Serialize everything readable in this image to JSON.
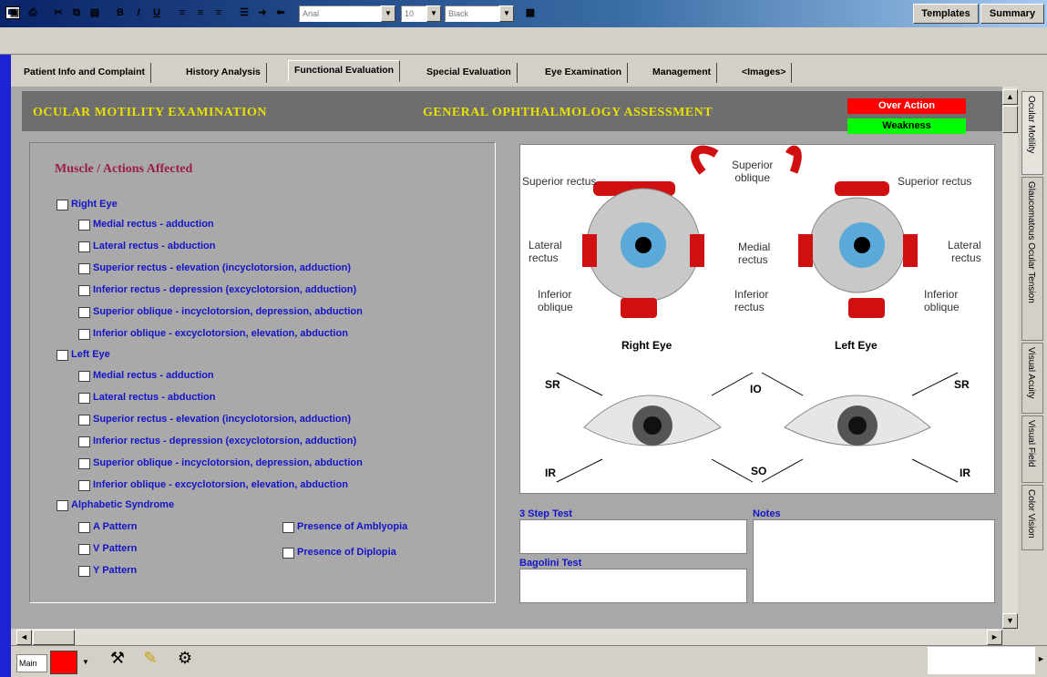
{
  "toolbar": {
    "bold": "B",
    "italic": "I",
    "underline": "U",
    "font_name": "Arial",
    "font_size": "10",
    "font_color": "Black",
    "templates_label": "Templates",
    "summary_label": "Summary"
  },
  "window": {
    "minimize": "_",
    "restore": "□",
    "close": "x"
  },
  "tabs": [
    "Patient Info and Complaint",
    "History Analysis",
    "Functional Evaluation",
    "Special Evaluation",
    "Eye Examination",
    "Management",
    "<Images>"
  ],
  "header": {
    "left_title": "OCULAR MOTILITY EXAMINATION",
    "right_title": "GENERAL OPHTHALMOLOGY ASSESSMENT"
  },
  "legend": {
    "over_action": "Over Action",
    "weakness": "Weakness",
    "over_color": "#ff0000",
    "weak_color": "#00ff00"
  },
  "panel": {
    "title": "Muscle / Actions Affected",
    "right_eye": "Right Eye",
    "right_items": [
      "Medial rectus - adduction",
      "Lateral rectus - abduction",
      "Superior rectus - elevation (incyclotorsion, adduction)",
      "Inferior rectus - depression (excyclotorsion, adduction)",
      "Superior oblique - incyclotorsion, depression, abduction",
      "Inferior oblique - excyclotorsion, elevation, abduction"
    ],
    "left_eye": "Left Eye",
    "left_items": [
      "Medial rectus - adduction",
      "Lateral rectus - abduction",
      "Superior rectus - elevation (incyclotorsion, adduction)",
      "Inferior rectus - depression (excyclotorsion, adduction)",
      "Superior oblique - incyclotorsion, depression, abduction",
      "Inferior oblique - excyclotorsion, elevation, abduction"
    ],
    "alphabetic": "Alphabetic Syndrome",
    "patterns": [
      "A Pattern",
      "V Pattern",
      "Y Pattern"
    ],
    "amblyopia": "Presence of Amblyopia",
    "diplopia": "Presence of Diplopia"
  },
  "diagram": {
    "superior_rectus_l": "Superior rectus",
    "superior_oblique": "Superior\noblique",
    "superior_rectus_r": "Superior rectus",
    "lateral_rectus_l": "Lateral\nrectus",
    "medial_rectus": "Medial\nrectus",
    "lateral_rectus_r": "Lateral\nrectus",
    "inferior_oblique_l": "Inferior\noblique",
    "inferior_rectus": "Inferior\nrectus",
    "inferior_oblique_r": "Inferior\noblique",
    "right_eye": "Right Eye",
    "left_eye": "Left Eye",
    "sr": "SR",
    "io": "IO",
    "ir": "IR",
    "so": "SO"
  },
  "fields": {
    "three_step": "3 Step Test",
    "bagolini": "Bagolini Test",
    "notes": "Notes"
  },
  "side_tabs": [
    "Ocular Motility",
    "Glaucomatous Ocular Tension",
    "Visual Acuity",
    "Visual Field",
    "Color Vision"
  ],
  "status": {
    "mode": "Main"
  }
}
